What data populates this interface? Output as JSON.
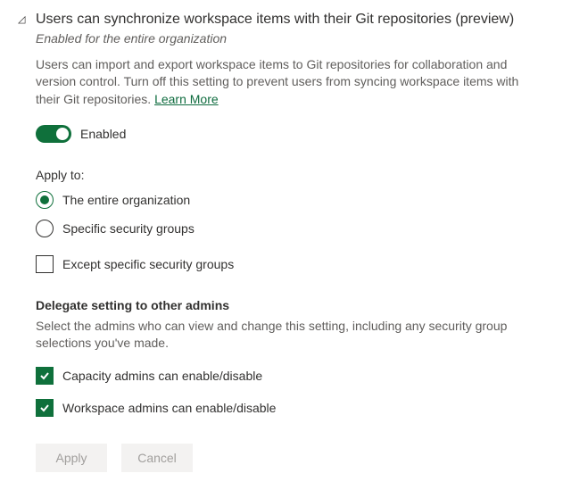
{
  "header": {
    "title": "Users can synchronize workspace items with their Git repositories (preview)",
    "subtitle": "Enabled for the entire organization",
    "description": "Users can import and export workspace items to Git repositories for collaboration and version control. Turn off this setting to prevent users from syncing workspace items with their Git repositories. ",
    "learn_more": "Learn More"
  },
  "toggle": {
    "state": "on",
    "label": "Enabled"
  },
  "apply_to": {
    "label": "Apply to:",
    "options": [
      {
        "label": "The entire organization",
        "selected": true
      },
      {
        "label": "Specific security groups",
        "selected": false
      }
    ],
    "except": {
      "label": "Except specific security groups",
      "checked": false
    }
  },
  "delegate": {
    "title": "Delegate setting to other admins",
    "description": "Select the admins who can view and change this setting, including any security group selections you've made.",
    "options": [
      {
        "label": "Capacity admins can enable/disable",
        "checked": true
      },
      {
        "label": "Workspace admins can enable/disable",
        "checked": true
      }
    ]
  },
  "buttons": {
    "apply": "Apply",
    "cancel": "Cancel"
  }
}
